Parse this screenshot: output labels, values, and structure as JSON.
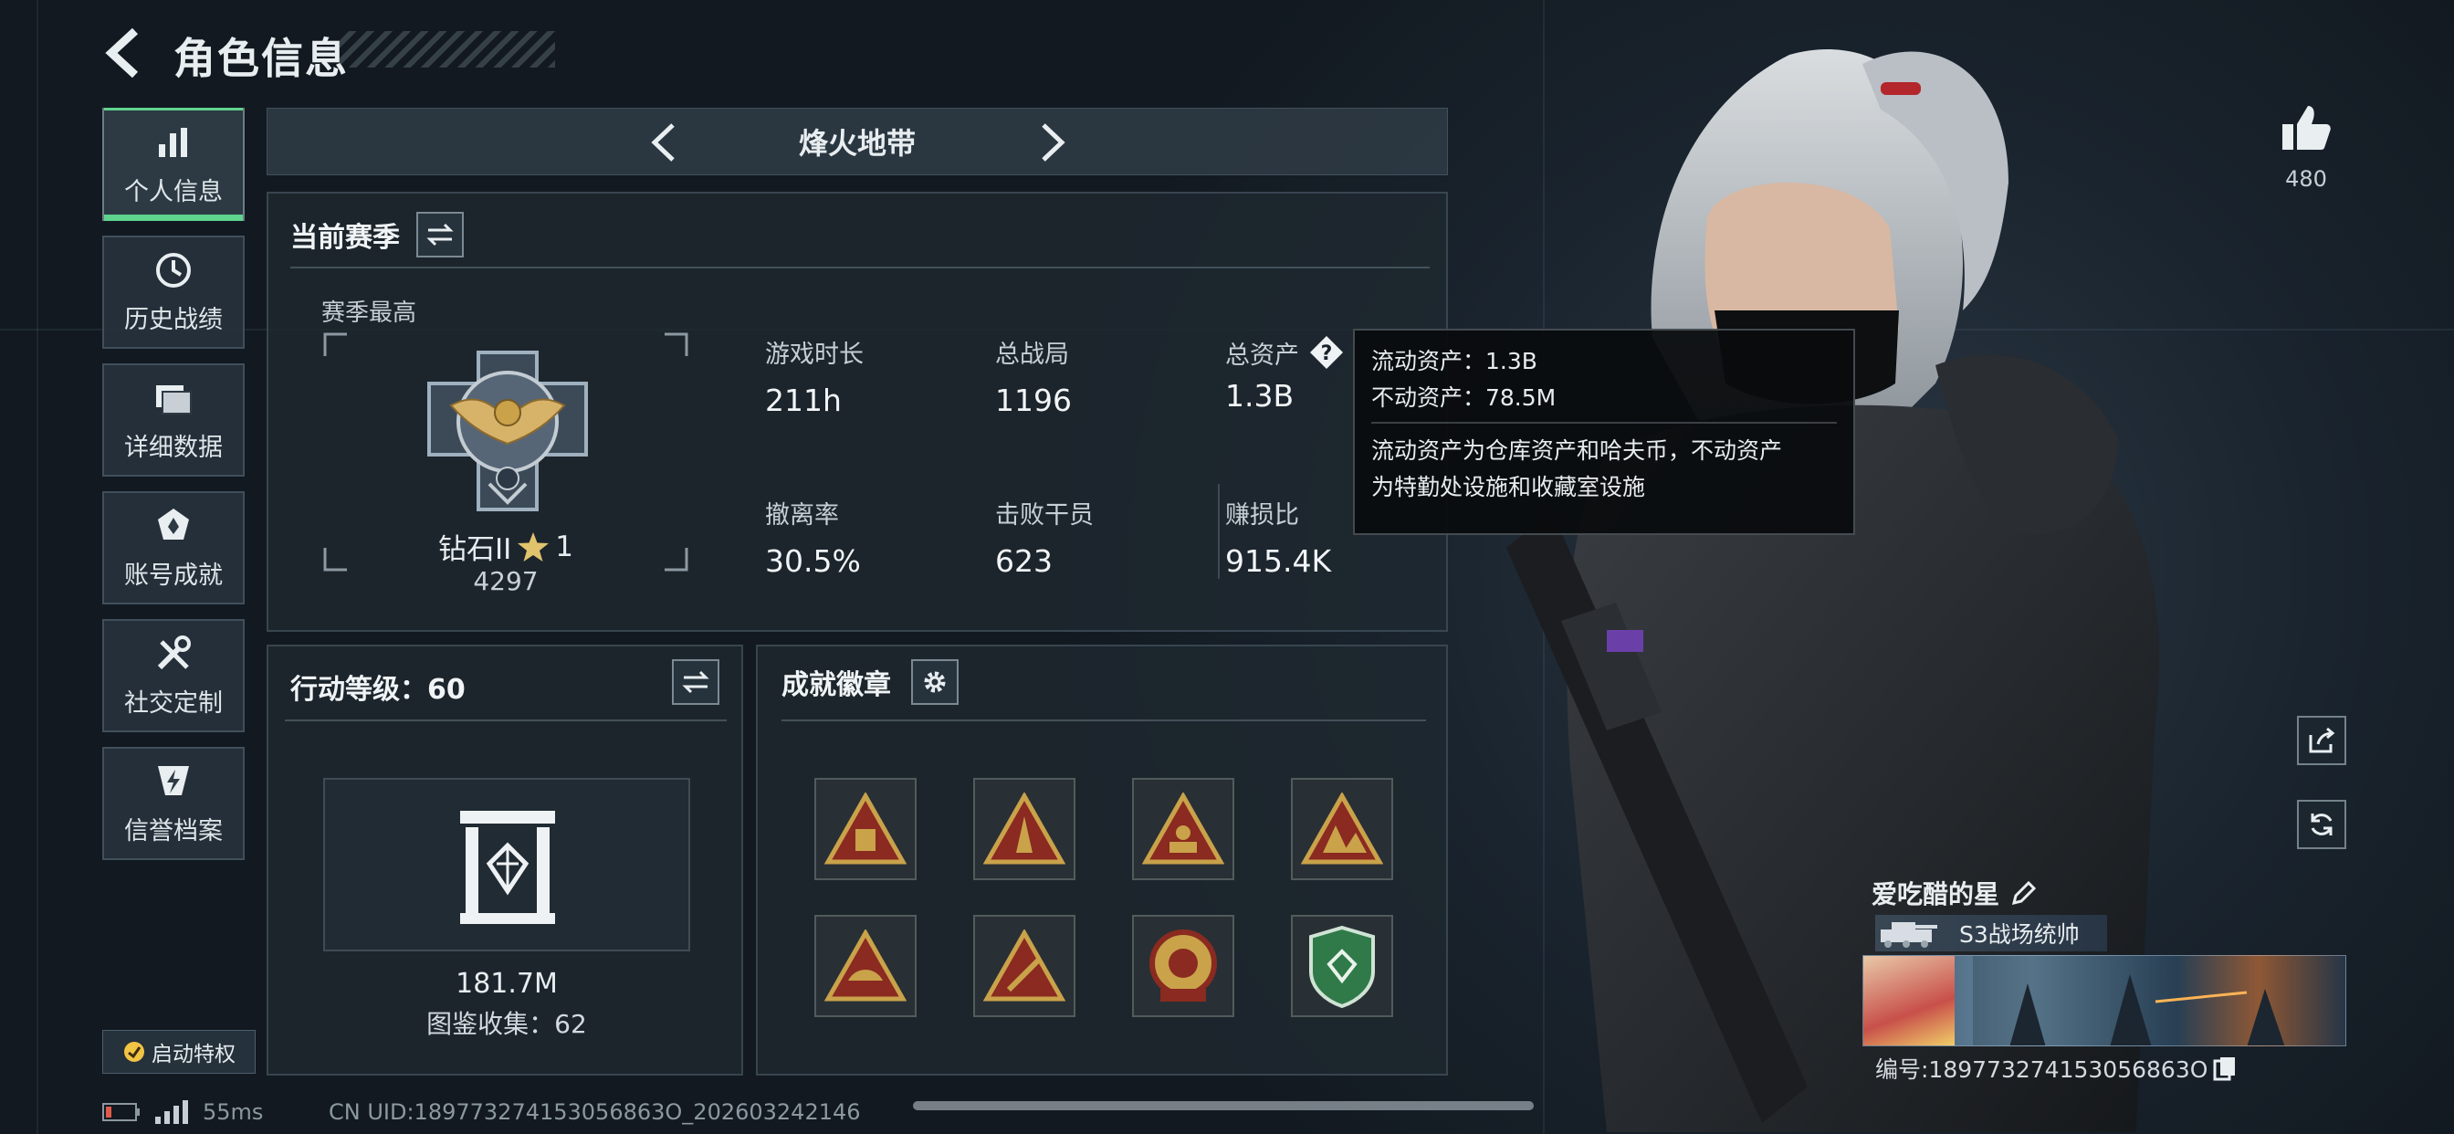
{
  "header": {
    "title": "角色信息"
  },
  "sidebar": {
    "items": [
      {
        "label": "个人信息",
        "icon": "bar-chart-icon",
        "active": true
      },
      {
        "label": "历史战绩",
        "icon": "clock-history-icon"
      },
      {
        "label": "详细数据",
        "icon": "folder-icon"
      },
      {
        "label": "账号成就",
        "icon": "medal-icon"
      },
      {
        "label": "社交定制",
        "icon": "tools-icon"
      },
      {
        "label": "信誉档案",
        "icon": "shield-bolt-icon"
      }
    ],
    "privilege_label": "启动特权"
  },
  "mode": {
    "title": "烽火地带"
  },
  "season": {
    "title": "当前赛季",
    "best_label": "赛季最高",
    "rank_name": "钻石II",
    "rank_stars": "1",
    "rank_points": "4297",
    "stats": [
      {
        "label": "游戏时长",
        "value": "211h"
      },
      {
        "label": "总战局",
        "value": "1196"
      },
      {
        "label": "总资产",
        "value": "1.3B"
      },
      {
        "label": "撤离率",
        "value": "30.5%"
      },
      {
        "label": "击败干员",
        "value": "623"
      },
      {
        "label": "赚损比",
        "value": "915.4K"
      }
    ]
  },
  "tooltip": {
    "line1": "流动资产：1.3B",
    "line2": "不动资产：78.5M",
    "desc1": "流动资产为仓库资产和哈夫币，不动资产",
    "desc2": "为特勤处设施和收藏室设施"
  },
  "action_level": {
    "title": "行动等级：60",
    "value": "181.7M",
    "collection": "图鉴收集：62"
  },
  "achievements": {
    "title": "成就徽章"
  },
  "likes": {
    "count": "480"
  },
  "player": {
    "name": "爱吃醋的星",
    "rank_title": "S3战场统帅",
    "id_text": "编号:189773274153056863O"
  },
  "footer": {
    "ping": "55ms",
    "uid": "CN UID:189773274153056863O_202603242146"
  },
  "colors": {
    "accent": "#5fd48e",
    "badge_gold": "#c9a24a",
    "badge_red": "#8a2a20",
    "badge_green": "#2f7a48"
  }
}
